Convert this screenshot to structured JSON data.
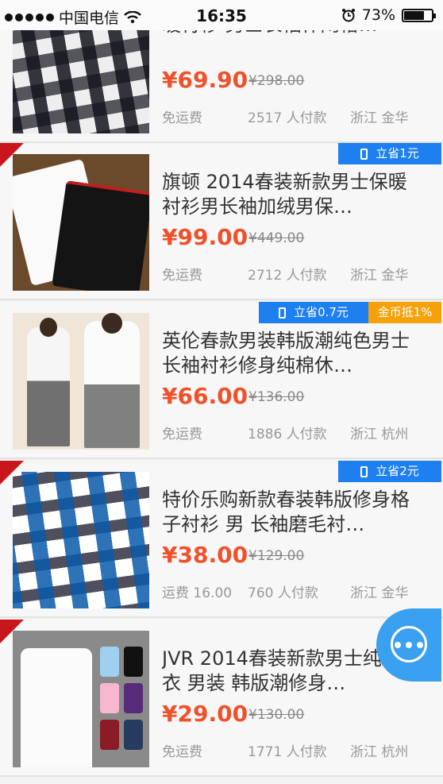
{
  "status_bar": {
    "carrier": "中国电信",
    "time": "16:35",
    "battery": "73%",
    "battery_level": 0.73
  },
  "products": [
    {
      "title": "暖衬衫 男士长袖休闲格…",
      "price": "¥69.90",
      "original_price": "¥298.00",
      "shipping": "免运费",
      "sold": "2517 人付款",
      "location": "浙江 金华",
      "tags": []
    },
    {
      "title": "旗顿 2014春装新款男士保暖衬衫男长袖加绒男保…",
      "price": "¥99.00",
      "original_price": "¥449.00",
      "shipping": "免运费",
      "sold": "2712 人付款",
      "location": "浙江 金华",
      "tags": [
        {
          "text": "立省1元",
          "color": "#1e7ff0"
        }
      ]
    },
    {
      "title": "英伦春款男装韩版潮纯色男士长袖衬衫修身纯棉休…",
      "price": "¥66.00",
      "original_price": "¥136.00",
      "shipping": "免运费",
      "sold": "1886 人付款",
      "location": "浙江 杭州",
      "tags": [
        {
          "text": "立省0.7元",
          "color": "#1e7ff0"
        },
        {
          "text": "金币抵1%",
          "color": "#f5a10c"
        }
      ]
    },
    {
      "title": "特价乐购新款春装韩版修身格子衬衫 男 长袖磨毛衬…",
      "price": "¥38.00",
      "original_price": "¥129.00",
      "shipping": "运费 16.00",
      "sold": "760 人付款",
      "location": "浙江 金华",
      "tags": [
        {
          "text": "立省2元",
          "color": "#1e7ff0"
        }
      ]
    },
    {
      "title": "JVR 2014春装新款男士纯色衬衣 男装 韩版潮修身…",
      "price": "¥29.00",
      "original_price": "¥130.00",
      "shipping": "免运费",
      "sold": "1771 人付款",
      "location": "浙江 杭州",
      "tags": []
    }
  ],
  "icons": {
    "wifi": "wifi-icon",
    "alarm": "alarm-icon",
    "chat": "chat-icon",
    "phone": "phone-icon"
  }
}
